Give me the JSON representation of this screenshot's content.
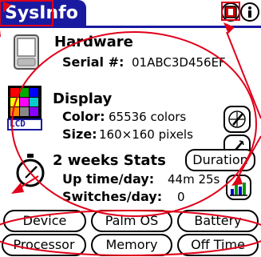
{
  "app": {
    "title": "SysInfo"
  },
  "hardware": {
    "heading": "Hardware",
    "serial_label": "Serial #:",
    "serial_value": "01ABC3D456EF"
  },
  "display": {
    "heading": "Display",
    "color_label": "Color:",
    "color_value": "65536 colors",
    "size_label": "Size:",
    "size_value": "160×160 pixels",
    "lcd_label": "LCD"
  },
  "stats": {
    "heading": "2 weeks Stats",
    "duration_button": "Duration",
    "uptime_label": "Up time/day:",
    "uptime_value": "44m 25s",
    "switches_label": "Switches/day:",
    "switches_value": "0"
  },
  "tabs": [
    {
      "label": "Device"
    },
    {
      "label": "Palm OS"
    },
    {
      "label": "Battery"
    },
    {
      "label": "Processor"
    },
    {
      "label": "Memory"
    },
    {
      "label": "Off Time"
    }
  ],
  "colors": {
    "title_bar": "#1a1aa0",
    "annotation": "#e0001a",
    "record_button": "#cc0000"
  },
  "icons": [
    "device-icon",
    "palette-icon",
    "stopwatch-icon",
    "bar-chart-icon",
    "record-icon",
    "info-icon",
    "stylus-icon",
    "calibrate-icon"
  ]
}
